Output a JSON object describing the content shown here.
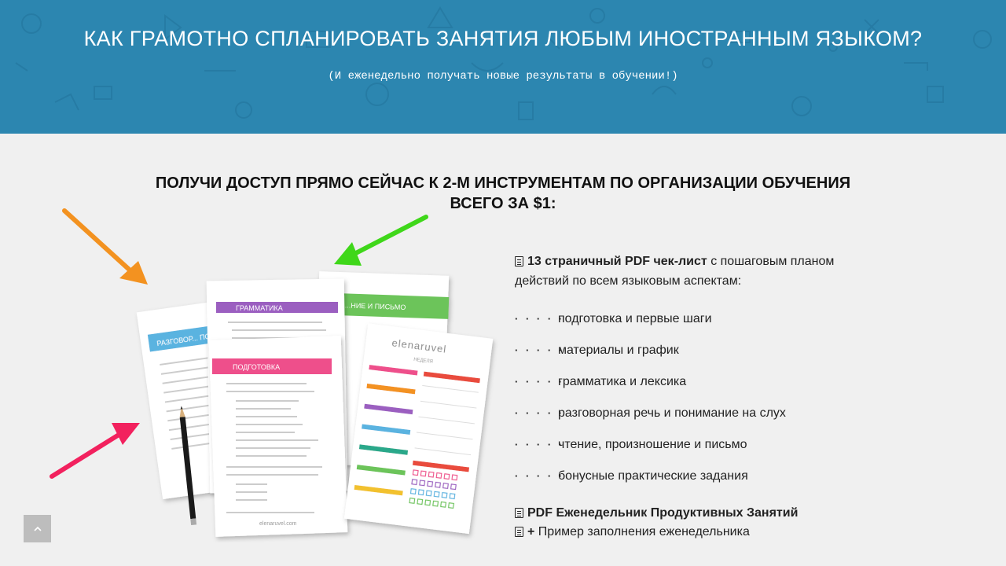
{
  "hero": {
    "title": "КАК ГРАМОТНО СПЛАНИРОВАТЬ ЗАНЯТИЯ ЛЮБЫМ ИНОСТРАННЫМ ЯЗЫКОМ?",
    "subtitle": "(И еженедельно получать новые результаты в обучении!)",
    "bg_color": "#2c86b0"
  },
  "headline": {
    "line1": "ПОЛУЧИ ДОСТУП ПРЯМО СЕЙЧАС К 2-М ИНСТРУМЕНТАМ ПО ОРГАНИЗАЦИИ ОБУЧЕНИЯ",
    "line2": "ВСЕГО ЗА $1:"
  },
  "promo": {
    "brand": "elenaruvel",
    "site": "elenaruvel.com",
    "sheet_grammar": "ГРАММАТИКА",
    "sheet_prep": "ПОДГОТОВКА",
    "sheet_speaking": "РАЗГОВОР... ПОНИМАНИ...",
    "sheet_writing": "...НИЕ И ПИСЬМО",
    "sheet_week": "НЕДЕЛЯ"
  },
  "offer": {
    "item1_bold": "13 страничный PDF чек-лист",
    "item1_rest": " с пошаговым планом действий по всем языковым аспектам:",
    "aspects": [
      "подготовка и первые шаги",
      "материалы и график",
      "грамматика и лексика",
      "разговорная речь и понимание на слух",
      "чтение, произношение и письмо",
      "бонусные практические задания"
    ],
    "bullet": "· · · · ·",
    "item2": "PDF Еженедельник Продуктивных Занятий",
    "item3_plus": "+",
    "item3_rest": " Пример заполнения еженедельника"
  },
  "colors": {
    "arrow_orange": "#f39220",
    "arrow_green": "#3fd71a",
    "arrow_pink": "#f2215e"
  },
  "icons": [
    "file-text-icon",
    "chevron-up-icon"
  ]
}
